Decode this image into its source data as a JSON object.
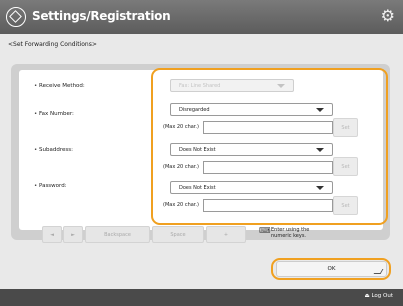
{
  "header": {
    "title": "Settings/Registration"
  },
  "page": {
    "subtitle": "<Set Forwarding Conditions>"
  },
  "form": {
    "receive_method": {
      "label": "Receive Method:",
      "value": "Fax: Line Shared"
    },
    "fax_number": {
      "label": "Fax Number:",
      "value": "Disregarded",
      "max_label": "(Max 20 char.)",
      "set_label": "Set"
    },
    "subaddress": {
      "label": "Subaddress:",
      "value": "Does Not Exist",
      "max_label": "(Max 20 char.)",
      "set_label": "Set"
    },
    "password": {
      "label": "Password:",
      "value": "Does Not Exist",
      "max_label": "(Max 20 char.)",
      "set_label": "Set"
    }
  },
  "keyboard_bar": {
    "left_label": "◄",
    "right_label": "►",
    "backspace_label": "Backspace",
    "space_label": "Space",
    "plus_label": "+",
    "note": "Enter using the numeric keys."
  },
  "actions": {
    "ok_label": "OK"
  },
  "footer": {
    "logout_label": "Log Out"
  }
}
